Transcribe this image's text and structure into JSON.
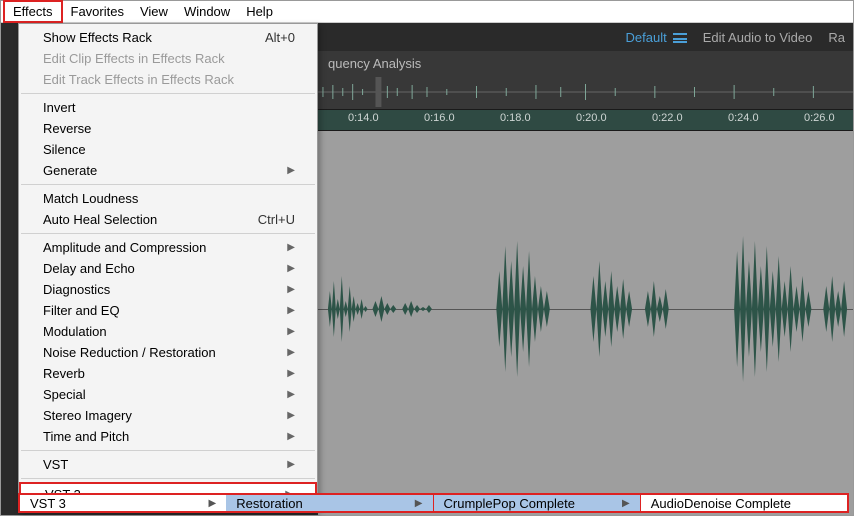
{
  "menubar": {
    "items": [
      "Effects",
      "Favorites",
      "View",
      "Window",
      "Help"
    ],
    "active_index": 0
  },
  "workspace": {
    "default": "Default",
    "edit_av": "Edit Audio to Video",
    "ra": "Ra"
  },
  "panel_tab": "quency Analysis",
  "ruler": {
    "ticks": [
      "0:14.0",
      "0:16.0",
      "0:18.0",
      "0:20.0",
      "0:22.0",
      "0:24.0",
      "0:26.0"
    ]
  },
  "dropdown": {
    "groups": [
      [
        {
          "label": "Show Effects Rack",
          "shortcut": "Alt+0"
        },
        {
          "label": "Edit Clip Effects in Effects Rack",
          "disabled": true
        },
        {
          "label": "Edit Track Effects in Effects Rack",
          "disabled": true
        }
      ],
      [
        {
          "label": "Invert"
        },
        {
          "label": "Reverse"
        },
        {
          "label": "Silence"
        },
        {
          "label": "Generate",
          "submenu": true
        }
      ],
      [
        {
          "label": "Match Loudness"
        },
        {
          "label": "Auto Heal Selection",
          "shortcut": "Ctrl+U"
        }
      ],
      [
        {
          "label": "Amplitude and Compression",
          "submenu": true
        },
        {
          "label": "Delay and Echo",
          "submenu": true
        },
        {
          "label": "Diagnostics",
          "submenu": true
        },
        {
          "label": "Filter and EQ",
          "submenu": true
        },
        {
          "label": "Modulation",
          "submenu": true
        },
        {
          "label": "Noise Reduction / Restoration",
          "submenu": true
        },
        {
          "label": "Reverb",
          "submenu": true
        },
        {
          "label": "Special",
          "submenu": true
        },
        {
          "label": "Stereo Imagery",
          "submenu": true
        },
        {
          "label": "Time and Pitch",
          "submenu": true
        }
      ],
      [
        {
          "label": "VST",
          "submenu": true
        }
      ],
      [
        {
          "label": "VST 3",
          "submenu": true,
          "highlight": true
        }
      ]
    ]
  },
  "breadcrumbs": {
    "c1": "VST 3",
    "c2": "Restoration",
    "c3": "CrumplePop Complete",
    "c4": "AudioDenoise Complete"
  }
}
